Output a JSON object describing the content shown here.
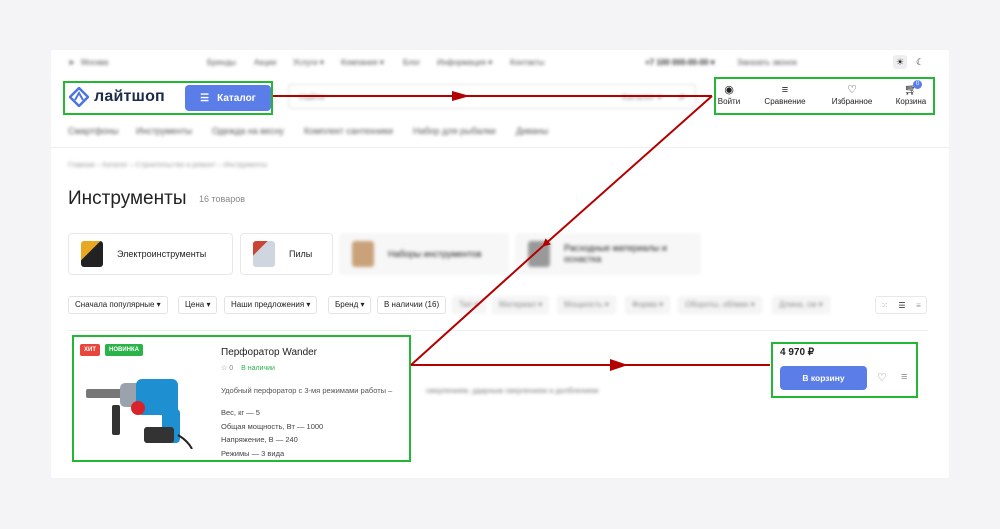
{
  "topbar": {
    "city": "Москва",
    "links": [
      "Бренды",
      "Акции",
      "Услуги ▾",
      "Компания ▾",
      "Блог",
      "Информация ▾",
      "Контакты"
    ],
    "phone": "+7 100 000-00-00 ▾",
    "callback": "Заказать звонок"
  },
  "header": {
    "logo_text": "лайтшоп",
    "catalog_label": "Каталог",
    "search_placeholder": "Найти",
    "search_scope": "Каталог ▾",
    "actions": {
      "login": "Войти",
      "compare": "Сравнение",
      "favorites": "Избранное",
      "cart": "Корзина",
      "cart_count": "0"
    }
  },
  "nav": [
    "Смартфоны",
    "Инструменты",
    "Одежда на весну",
    "Комплект сантехники",
    "Набор для рыбалки",
    "Диваны"
  ],
  "breadcrumbs": "Главная  –  Каталог  –  Строительство и ремонт  –  Инструменты",
  "page": {
    "title": "Инструменты",
    "count": "16 товаров"
  },
  "categories": [
    "Электроинструменты",
    "Пилы",
    "Наборы инструментов",
    "Расходные материалы и оснастка"
  ],
  "filters": {
    "sort": "Сначала популярные ▾",
    "items": [
      "Цена ▾",
      "Наши предложения ▾",
      "Бренд ▾",
      "В наличии (16)"
    ],
    "blurred": [
      "Тип ▾",
      "Материал ▾",
      "Мощность ▾",
      "Форма ▾",
      "Обороты, об/мин ▾",
      "Длина, см ▾"
    ]
  },
  "product": {
    "tags": [
      "ХИТ",
      "НОВИНКА"
    ],
    "name": "Перфоратор Wander",
    "rating": "0",
    "availability": "В наличии",
    "description": "Удобный перфоратор с 3-мя режимами работы –",
    "description_rest": "сверлением, ударным сверлением и долблением",
    "specs": [
      "Вес, кг — 5",
      "Общая мощность, Вт — 1000",
      "Напряжение, В — 240",
      "Режимы — 3 вида"
    ],
    "price": "4 970 ₽",
    "buy_label": "В корзину"
  },
  "colors": {
    "accent": "#5b7de8",
    "highlight": "#22b833",
    "arrow": "#b30000",
    "hit": "#e8453c",
    "new": "#2bb34a"
  }
}
